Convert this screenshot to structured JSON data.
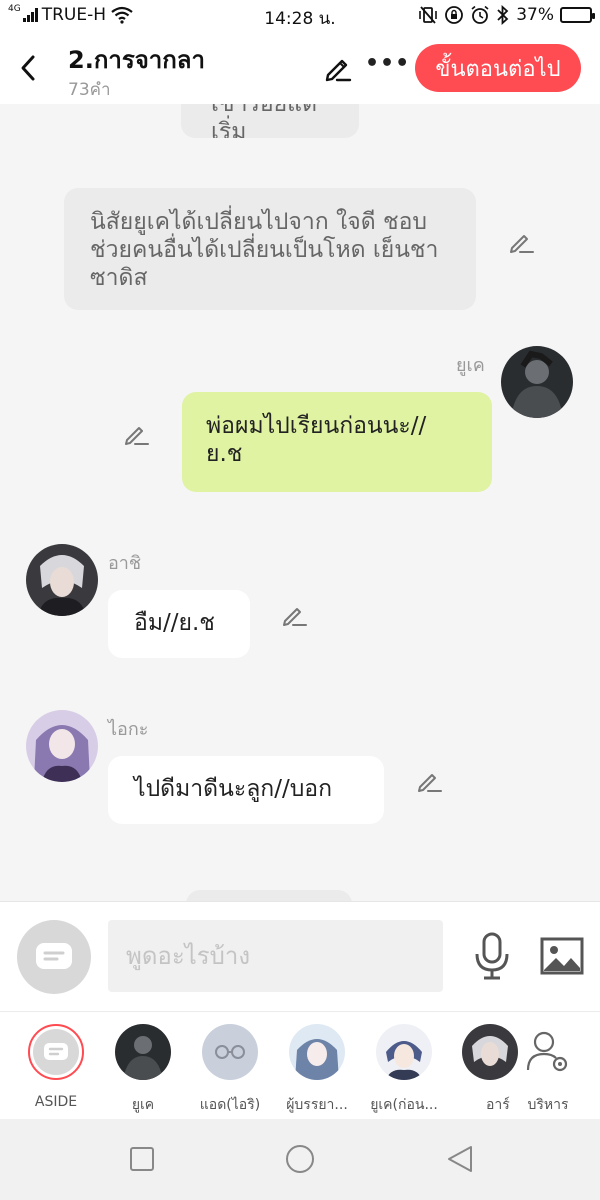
{
  "status_bar": {
    "network_type": "4G",
    "carrier": "TRUE-H",
    "time": "14:28 น.",
    "battery_percent": "37%",
    "battery_level": 0.37,
    "icons": [
      "wifi-icon",
      "vibrate-off-icon",
      "rotation-lock-icon",
      "alarm-icon",
      "bluetooth-icon",
      "battery-icon"
    ]
  },
  "header": {
    "title": "2.การจากลา",
    "subtitle": "73คำ",
    "next_button": "ขั้นตอนต่อไป",
    "accent_color": "#ff4b52"
  },
  "messages": [
    {
      "type": "narration",
      "text": "เขารอยแต่เริ่ม",
      "partial": true
    },
    {
      "type": "narration",
      "lines": [
        "นิสัยยูเคได้เปลี่ยนไปจาก ใจดี ชอบ",
        "ช่วยคนอื่นได้เปลี่ยนเป็นโหด เย็นชา",
        "ซาดิส"
      ]
    },
    {
      "type": "self",
      "name": "ยูเค",
      "lines": [
        "พ่อผมไปเรียนก่อนนะ//",
        "ย.ช"
      ]
    },
    {
      "type": "other",
      "name": "อาชิ",
      "text": "อืม//ย.ช"
    },
    {
      "type": "other",
      "name": "ไอกะ",
      "text": "ไปดีมาดีนะลูก//บอก"
    }
  ],
  "input": {
    "placeholder": "พูดอะไรบ้าง",
    "value": ""
  },
  "characters": [
    {
      "label": "ASIDE"
    },
    {
      "label": "ยูเค"
    },
    {
      "label": "แอด(ไอริ)"
    },
    {
      "label": "ผู้บรรยา..."
    },
    {
      "label": "ยูเค(ก่อน..."
    },
    {
      "label": "อาร์"
    },
    {
      "label": "บริหาร"
    }
  ],
  "colors": {
    "self_bubble": "#dff3a3",
    "narration_bubble": "#ebebeb",
    "other_bubble": "#ffffff"
  }
}
